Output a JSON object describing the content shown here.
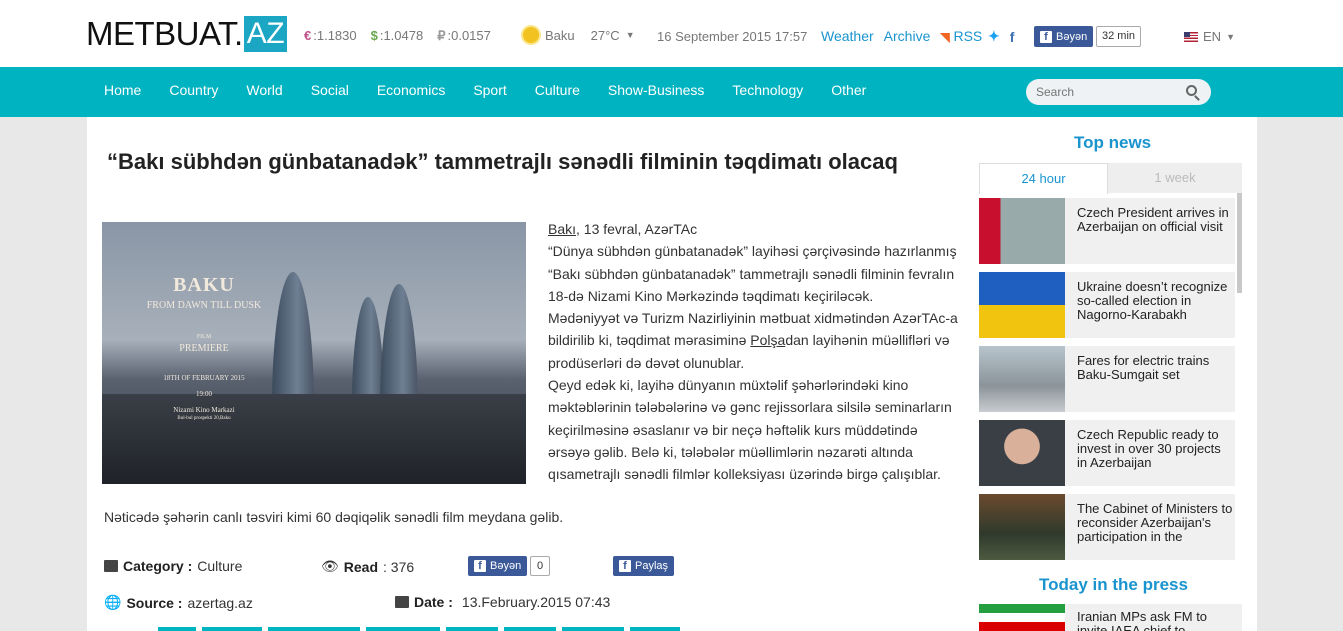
{
  "header": {
    "logo_main": "METBUAT.",
    "logo_az": "AZ",
    "rates": [
      {
        "symbol": "€",
        "value": ":1.1830",
        "color": "#c0508a"
      },
      {
        "symbol": "$",
        "value": ":1.0478",
        "color": "#6aa84f"
      },
      {
        "symbol": "₽",
        "value": ":0.0157",
        "color": "#999999"
      }
    ],
    "city": "Baku",
    "temp": "27°C",
    "datetime": "16 September 2015 17:57",
    "links": [
      "Weather",
      "Archive",
      "RSS"
    ],
    "fb_label": "Bəyən",
    "fb_count": "32 min",
    "lang": "EN"
  },
  "nav": {
    "items": [
      "Home",
      "Country",
      "World",
      "Social",
      "Economics",
      "Sport",
      "Culture",
      "Show-Business",
      "Technology",
      "Other"
    ],
    "search_placeholder": "Search"
  },
  "article": {
    "title": "“Bakı sübhdən günbatanadək” tammetrajlı sənədli filminin təqdimatı olacaq",
    "photo": {
      "title": "BAKU",
      "subtitle": "FROM DAWN TILL DUSK",
      "film": "FILM",
      "premiere": "PREMIERE",
      "date": "18TH OF FEBRUARY 2015",
      "time": "19:00",
      "venue": "Nizami Kino Markazi",
      "address": "Bul-bul prospekti 20,Baku"
    },
    "dateline_city": "Bakı",
    "dateline_rest": ", 13 fevral, AzərTAc",
    "p1": "“Dünya sübhdən günbatanadək” layihəsi çərçivəsində hazırlanmış “Bakı sübhdən günbatanadək” tammetrajlı sənədli filminin fevralın 18-də Nizami Kino Mərkəzində təqdimatı keçiriləcək.",
    "p2a": "Mədəniyyət və Turizm Nazirliyinin mətbuat xidmətindən AzərTAc-a bildirilib ki, təqdimat mərasiminə ",
    "p2link": "Polşa",
    "p2b": "dan layihənin müəllifləri və prodüserləri də dəvət olunublar.",
    "p3": "Qeyd edək ki, layihə dünyanın müxtəlif şəhərlərindəki kino məktəblərinin tələbələrinə və gənc rejissorlara silsilə seminarların keçirilməsinə əsaslanır və bir neçə həftəlik kurs müddətində ərsəyə gəlib. Belə ki, tələbələr müəllimlərin nəzarəti altında qısametrajlı sənədli filmlər kolleksiyası üzərində birgə çalışıblar.",
    "p4": "Nəticədə şəhərin canlı təsviri kimi 60 dəqiqəlik sənədli film meydana gəlib.",
    "category_label": "Category :",
    "category": "Culture",
    "read_label": "Read",
    "read": ": 376",
    "like_label": "Bəyən",
    "like_count": "0",
    "share_label": "Paylaş",
    "source_label": "Source :",
    "source": "azertag.az",
    "date_label": "Date :",
    "date": "13.February.2015 07:43"
  },
  "sidebar": {
    "top_news": "Top news",
    "tab_24h": "24 hour",
    "tab_week": "1 week",
    "news": [
      "Czech President arrives in Azerbaijan on official visit",
      "Ukraine doesn’t recognize so-called election in Nagorno-Karabakh",
      "Fares for electric trains Baku-Sumgait set",
      "Czech Republic ready to invest in over 30 projects in Azerbaijan",
      "The Cabinet of Ministers to reconsider Azerbaijan's participation in the"
    ],
    "today_press": "Today in the press",
    "press_news": "Iranian MPs ask FM to invite IAEA chief to"
  }
}
